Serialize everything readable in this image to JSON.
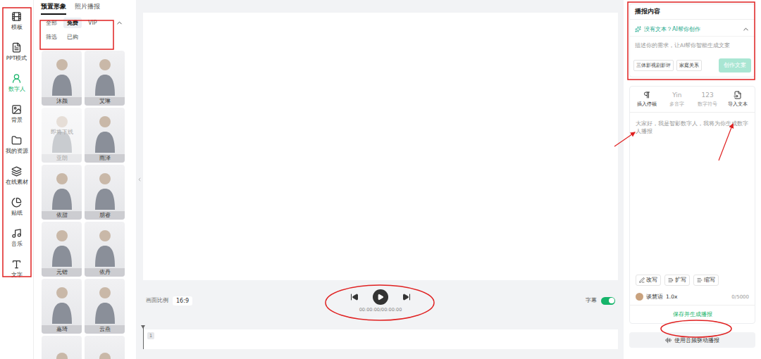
{
  "sidebar": {
    "items": [
      {
        "label": "模板",
        "selected": false
      },
      {
        "label": "PPT模式",
        "selected": false
      },
      {
        "label": "数字人",
        "selected": true
      },
      {
        "label": "背景",
        "selected": false
      },
      {
        "label": "我的资源",
        "selected": false
      },
      {
        "label": "在线素材",
        "selected": false
      },
      {
        "label": "贴纸",
        "selected": false
      },
      {
        "label": "音乐",
        "selected": false
      },
      {
        "label": "文字",
        "selected": false
      }
    ]
  },
  "avatar_panel": {
    "tabs": [
      {
        "label": "预置形象",
        "selected": true
      },
      {
        "label": "照片播报",
        "selected": false
      }
    ],
    "filters": [
      [
        {
          "label": "全部",
          "selected": false
        },
        {
          "label": "免费",
          "selected": true
        },
        {
          "label": "VIP",
          "selected": false
        }
      ],
      [
        {
          "label": "筛选",
          "selected": false
        },
        {
          "label": "已购",
          "selected": false
        }
      ]
    ],
    "avatars": [
      {
        "name": "沐颜",
        "disabled": false,
        "badge": ""
      },
      {
        "name": "艾琳",
        "disabled": false,
        "badge": ""
      },
      {
        "name": "亚朗",
        "disabled": true,
        "badge": "即将下线"
      },
      {
        "name": "雨泽",
        "disabled": false,
        "badge": ""
      },
      {
        "name": "依甜",
        "disabled": false,
        "badge": ""
      },
      {
        "name": "朋睿",
        "disabled": false,
        "badge": ""
      },
      {
        "name": "元锴",
        "disabled": false,
        "badge": ""
      },
      {
        "name": "依丹",
        "disabled": false,
        "badge": ""
      },
      {
        "name": "嘉琦",
        "disabled": false,
        "badge": ""
      },
      {
        "name": "云燕",
        "disabled": false,
        "badge": ""
      },
      {
        "name": "",
        "disabled": false,
        "badge": ""
      },
      {
        "name": "",
        "disabled": false,
        "badge": ""
      }
    ]
  },
  "player": {
    "aspect_label": "画面比例",
    "aspect": "16:9",
    "time": "00:00:00/00:00:00",
    "subtitle_label": "字幕",
    "subtitle_on": true
  },
  "timeline": {
    "clips": [
      {
        "label": "1"
      }
    ]
  },
  "script_panel": {
    "title": "播报内容",
    "ai_prompt": "没有文本？AI帮你创作",
    "ai_expanded": true,
    "ai_placeholder": "描述你的需求，让AI帮你智能生成文案",
    "suggestions": [
      "三体影视剧影评",
      "家庭关系"
    ],
    "create_button": {
      "label": "创作文案",
      "disabled": true
    },
    "tools": [
      {
        "label": "插入停顿",
        "glyph": "",
        "kind": "icon",
        "disabled": false
      },
      {
        "label": "多音字",
        "glyph": "Yin",
        "kind": "glyph",
        "disabled": true
      },
      {
        "label": "数字符号",
        "glyph": "123",
        "kind": "glyph",
        "disabled": true
      },
      {
        "label": "导入文本",
        "glyph": "",
        "kind": "icon",
        "disabled": false
      }
    ],
    "text_placeholder": "大家好，我是智影数字人，我将为你生成数字人播报",
    "actions": [
      "改写",
      "扩写",
      "缩写"
    ],
    "voice": {
      "name": "谈慧语",
      "speed": "1.0x"
    },
    "count": "0/5000",
    "save_button": "保存并生成播报",
    "audio_button": "使用音频驱动播报"
  }
}
